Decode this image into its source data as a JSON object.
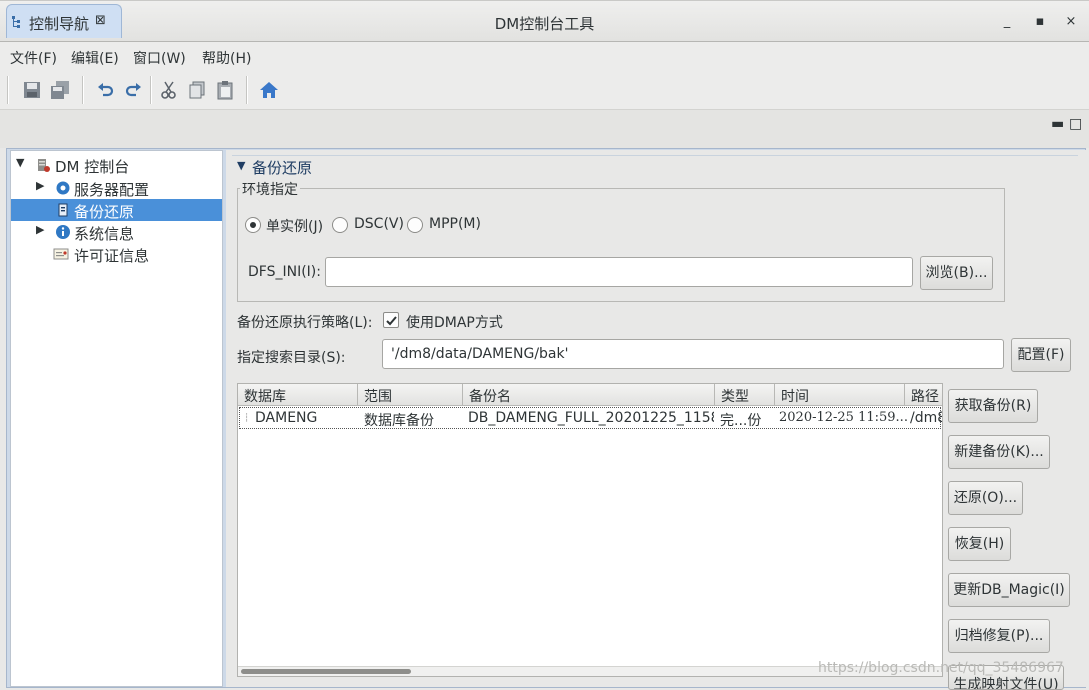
{
  "window": {
    "title": "DM控制台工具",
    "controls": [
      "_",
      "▪",
      "×"
    ]
  },
  "menu": [
    "文件(F)",
    "编辑(E)",
    "窗口(W)",
    "帮助(H)"
  ],
  "tabs": {
    "nav_tab": "控制导航"
  },
  "nav": {
    "items": [
      {
        "label": "DM 控制台",
        "expanded": true
      },
      {
        "label": "服务器配置"
      },
      {
        "label": "备份还原",
        "selected": true
      },
      {
        "label": "系统信息"
      },
      {
        "label": "许可证信息"
      }
    ]
  },
  "section": {
    "title": "备份还原"
  },
  "env": {
    "group_title": "环境指定",
    "radios": [
      "单实例(J)",
      "DSC(V)",
      "MPP(M)"
    ],
    "selected": "单实例(J)",
    "dfs_label": "DFS_INI(I):",
    "dfs_value": "",
    "browse_label": "浏览(B)..."
  },
  "strategy": {
    "label": "备份还原执行策略(L):",
    "checkbox_label": "使用DMAP方式",
    "checked": true
  },
  "search": {
    "label": "指定搜索目录(S):",
    "value": "'/dm8/data/DAMENG/bak'",
    "config_label": "配置(F)"
  },
  "table": {
    "headers": [
      "数据库",
      "范围",
      "备份名",
      "类型",
      "时间",
      "路径"
    ],
    "rows": [
      [
        "DAMENG",
        "数据库备份",
        "DB_DAMENG_FULL_20201225_1158..",
        "完...份",
        "2020-12-25 11:59...",
        "/dm8"
      ]
    ]
  },
  "actions": {
    "get_backup": "获取备份(R)",
    "new_backup": "新建备份(K)...",
    "restore": "还原(O)...",
    "recover": "恢复(H)",
    "update_magic": "更新DB_Magic(I)",
    "archive_repair": "归档修复(P)...",
    "map_file": "生成映射文件(U)"
  },
  "watermark": "https://blog.csdn.net/qq_35486967",
  "colors": {
    "selection": "#4a90d9",
    "section_title": "#1f3d63",
    "home_icon": "#3a78c9"
  }
}
